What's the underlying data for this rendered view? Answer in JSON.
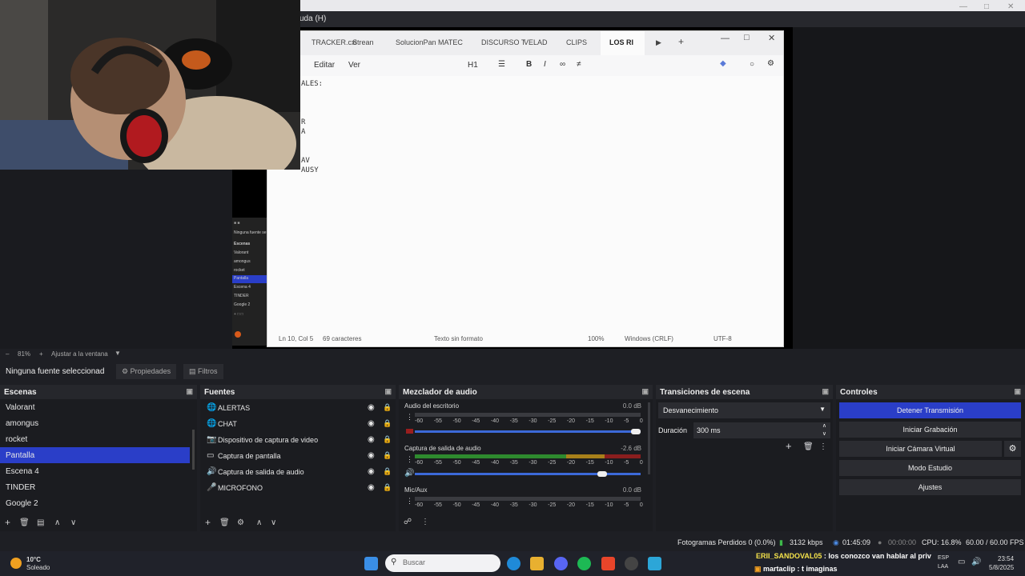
{
  "obs": {
    "menu_fragment": "uda (H)"
  },
  "notepad": {
    "tabs": [
      "TRACKER.cxi",
      "Strean",
      "SolucionPan",
      "MATEC",
      "DISCURSO T",
      "VELAD",
      "CLIPS",
      "LOS RI"
    ],
    "toolbar": {
      "edit": "Editar",
      "view": "Ver",
      "heading": "H1"
    },
    "text_lines": [
      "ALES:",
      "",
      "",
      "",
      "R",
      "A",
      "",
      "",
      "AV",
      "AUSY"
    ],
    "status": {
      "position": "Ln 10, Col 5",
      "chars": "69 caracteres",
      "format": "Texto sin formato",
      "zoom": "100%",
      "eol": "Windows (CRLF)",
      "encoding": "UTF-8"
    }
  },
  "mini_obs": {
    "label": "Ninguna fuente se",
    "scenes_head": "Escenas",
    "scenes": [
      "Valorant",
      "amongus",
      "rocket",
      "Pantalla",
      "Escena 4",
      "TINDER",
      "Google 2"
    ]
  },
  "zoom": {
    "value": "81%",
    "fit": "Ajustar a la ventana"
  },
  "toolbar": {
    "no_source": "Ninguna fuente seleccionad",
    "properties": "Propiedades",
    "filters": "Filtros"
  },
  "scenes": {
    "title": "Escenas",
    "items": [
      "Valorant",
      "amongus",
      "rocket",
      "Pantalla",
      "Escena 4",
      "TINDER",
      "Google 2"
    ],
    "selected_index": 3
  },
  "sources": {
    "title": "Fuentes",
    "items": [
      {
        "label": "ALERTAS",
        "icon": "globe-icon"
      },
      {
        "label": "CHAT",
        "icon": "globe-icon"
      },
      {
        "label": "Dispositivo de captura de video",
        "icon": "camera-icon"
      },
      {
        "label": "Captura de pantalla",
        "icon": "monitor-icon"
      },
      {
        "label": "Captura de salida de audio",
        "icon": "speaker-icon"
      },
      {
        "label": "MICROFONO",
        "icon": "mic-icon"
      }
    ]
  },
  "mixer": {
    "title": "Mezclador de audio",
    "ticks": [
      "-60",
      "-55",
      "-50",
      "-45",
      "-40",
      "-35",
      "-30",
      "-25",
      "-20",
      "-15",
      "-10",
      "-5",
      "0"
    ],
    "channels": [
      {
        "name": "Audio del escritorio",
        "db": "0.0 dB",
        "volume": 1.0
      },
      {
        "name": "Captura de salida de audio",
        "db": "-2.6 dB",
        "volume": 0.85
      },
      {
        "name": "Mic/Aux",
        "db": "0.0 dB",
        "volume": 1.0
      }
    ]
  },
  "transitions": {
    "title": "Transiciones de escena",
    "type": "Desvanecimiento",
    "duration_label": "Duración",
    "duration": "300 ms"
  },
  "controls": {
    "title": "Controles",
    "stop_stream": "Detener Transmisión",
    "start_record": "Iniciar Grabación",
    "virtual_cam": "Iniciar Cámara Virtual",
    "studio": "Modo Estudio",
    "settings": "Ajustes",
    "accent": "#2a3ec8"
  },
  "status": {
    "dropped": "Fotogramas Perdidos 0 (0.0%)",
    "bitrate": "3132 kbps",
    "stream_time": "01:45:09",
    "rec_time": "00:00:00",
    "cpu": "CPU: 16.8%",
    "fps": "60.00 / 60.00 FPS"
  },
  "taskbar": {
    "weather_temp": "10°C",
    "weather_desc": "Soleado",
    "search": "Buscar",
    "chat_line1_user": "ERII_SANDOVAL05",
    "chat_line1_msg": " : los conozco van hablar al priv",
    "chat_line2_user": "martaclip",
    "chat_line2_msg": " : t imaginas",
    "lang1": "ESP",
    "lang2": "LAA",
    "time": "23:54",
    "date": "5/8/2025"
  }
}
